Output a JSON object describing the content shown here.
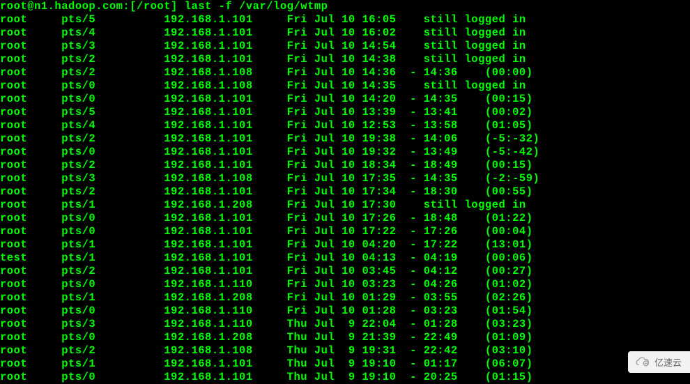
{
  "prompt": "root@n1.hadoop.com:[/root] last -f /var/log/wtmp",
  "rows": [
    {
      "user": "root",
      "tty": "pts/5",
      "host": "192.168.1.101",
      "login": "Fri Jul 10 16:05",
      "end": "still logged in",
      "dur": ""
    },
    {
      "user": "root",
      "tty": "pts/4",
      "host": "192.168.1.101",
      "login": "Fri Jul 10 16:02",
      "end": "still logged in",
      "dur": ""
    },
    {
      "user": "root",
      "tty": "pts/3",
      "host": "192.168.1.101",
      "login": "Fri Jul 10 14:54",
      "end": "still logged in",
      "dur": ""
    },
    {
      "user": "root",
      "tty": "pts/2",
      "host": "192.168.1.101",
      "login": "Fri Jul 10 14:38",
      "end": "still logged in",
      "dur": ""
    },
    {
      "user": "root",
      "tty": "pts/2",
      "host": "192.168.1.108",
      "login": "Fri Jul 10 14:36",
      "end": "- 14:36",
      "dur": "(00:00)"
    },
    {
      "user": "root",
      "tty": "pts/0",
      "host": "192.168.1.108",
      "login": "Fri Jul 10 14:35",
      "end": "still logged in",
      "dur": ""
    },
    {
      "user": "root",
      "tty": "pts/0",
      "host": "192.168.1.101",
      "login": "Fri Jul 10 14:20",
      "end": "- 14:35",
      "dur": "(00:15)"
    },
    {
      "user": "root",
      "tty": "pts/5",
      "host": "192.168.1.101",
      "login": "Fri Jul 10 13:39",
      "end": "- 13:41",
      "dur": "(00:02)"
    },
    {
      "user": "root",
      "tty": "pts/4",
      "host": "192.168.1.101",
      "login": "Fri Jul 10 12:53",
      "end": "- 13:58",
      "dur": "(01:05)"
    },
    {
      "user": "root",
      "tty": "pts/2",
      "host": "192.168.1.101",
      "login": "Fri Jul 10 19:38",
      "end": "- 14:06",
      "dur": "(-5:-32)"
    },
    {
      "user": "root",
      "tty": "pts/0",
      "host": "192.168.1.101",
      "login": "Fri Jul 10 19:32",
      "end": "- 13:49",
      "dur": "(-5:-42)"
    },
    {
      "user": "root",
      "tty": "pts/2",
      "host": "192.168.1.101",
      "login": "Fri Jul 10 18:34",
      "end": "- 18:49",
      "dur": "(00:15)"
    },
    {
      "user": "root",
      "tty": "pts/3",
      "host": "192.168.1.108",
      "login": "Fri Jul 10 17:35",
      "end": "- 14:35",
      "dur": "(-2:-59)"
    },
    {
      "user": "root",
      "tty": "pts/2",
      "host": "192.168.1.101",
      "login": "Fri Jul 10 17:34",
      "end": "- 18:30",
      "dur": "(00:55)"
    },
    {
      "user": "root",
      "tty": "pts/1",
      "host": "192.168.1.208",
      "login": "Fri Jul 10 17:30",
      "end": "still logged in",
      "dur": ""
    },
    {
      "user": "root",
      "tty": "pts/0",
      "host": "192.168.1.101",
      "login": "Fri Jul 10 17:26",
      "end": "- 18:48",
      "dur": "(01:22)"
    },
    {
      "user": "root",
      "tty": "pts/0",
      "host": "192.168.1.101",
      "login": "Fri Jul 10 17:22",
      "end": "- 17:26",
      "dur": "(00:04)"
    },
    {
      "user": "root",
      "tty": "pts/1",
      "host": "192.168.1.101",
      "login": "Fri Jul 10 04:20",
      "end": "- 17:22",
      "dur": "(13:01)"
    },
    {
      "user": "test",
      "tty": "pts/1",
      "host": "192.168.1.101",
      "login": "Fri Jul 10 04:13",
      "end": "- 04:19",
      "dur": "(00:06)"
    },
    {
      "user": "root",
      "tty": "pts/2",
      "host": "192.168.1.101",
      "login": "Fri Jul 10 03:45",
      "end": "- 04:12",
      "dur": "(00:27)"
    },
    {
      "user": "root",
      "tty": "pts/0",
      "host": "192.168.1.110",
      "login": "Fri Jul 10 03:23",
      "end": "- 04:26",
      "dur": "(01:02)"
    },
    {
      "user": "root",
      "tty": "pts/1",
      "host": "192.168.1.208",
      "login": "Fri Jul 10 01:29",
      "end": "- 03:55",
      "dur": "(02:26)"
    },
    {
      "user": "root",
      "tty": "pts/0",
      "host": "192.168.1.110",
      "login": "Fri Jul 10 01:28",
      "end": "- 03:23",
      "dur": "(01:54)"
    },
    {
      "user": "root",
      "tty": "pts/3",
      "host": "192.168.1.110",
      "login": "Thu Jul  9 22:04",
      "end": "- 01:28",
      "dur": "(03:23)"
    },
    {
      "user": "root",
      "tty": "pts/0",
      "host": "192.168.1.208",
      "login": "Thu Jul  9 21:39",
      "end": "- 22:49",
      "dur": "(01:09)"
    },
    {
      "user": "root",
      "tty": "pts/2",
      "host": "192.168.1.108",
      "login": "Thu Jul  9 19:31",
      "end": "- 22:42",
      "dur": "(03:10)"
    },
    {
      "user": "root",
      "tty": "pts/1",
      "host": "192.168.1.101",
      "login": "Thu Jul  9 19:10",
      "end": "- 01:17",
      "dur": "(06:07)"
    },
    {
      "user": "root",
      "tty": "pts/0",
      "host": "192.168.1.101",
      "login": "Thu Jul  9 19:10",
      "end": "- 20:25",
      "dur": "(01:15)"
    }
  ],
  "watermark": "亿速云"
}
